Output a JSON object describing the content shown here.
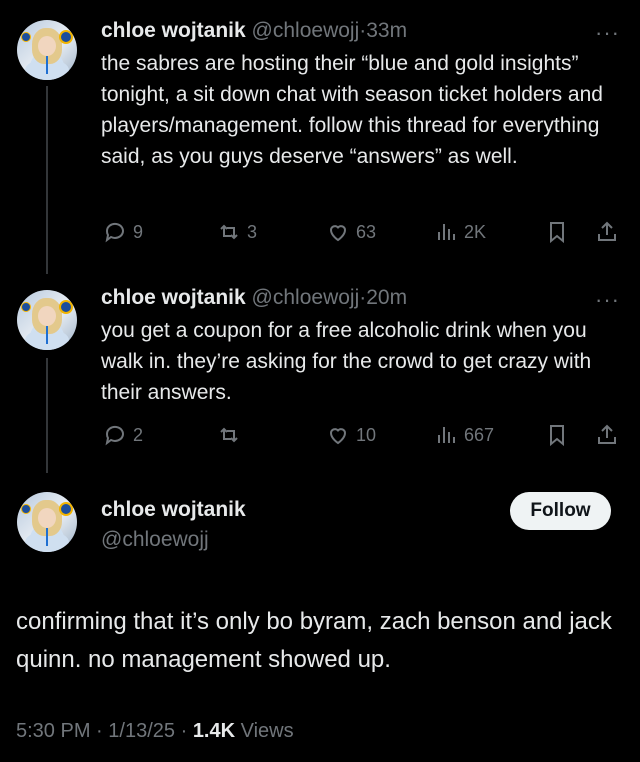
{
  "tweets": [
    {
      "name": "chloe wojtanik",
      "handle": "@chloewojj",
      "sep": "·",
      "time": "33m",
      "more": "···",
      "text": "the sabres are hosting their “blue and gold insights” tonight, a sit down chat with season ticket holders and players/management. follow this thread for everything said, as you guys deserve “answers” as well.",
      "replies": "9",
      "reposts": "3",
      "likes": "63",
      "views": "2K"
    },
    {
      "name": "chloe wojtanik",
      "handle": "@chloewojj",
      "sep": "·",
      "time": "20m",
      "more": "···",
      "text": "you get a coupon for a free alcoholic drink when you walk in. they’re asking for the crowd to get crazy with their answers.",
      "replies": "2",
      "reposts": "",
      "likes": "10",
      "views": "667"
    }
  ],
  "main": {
    "name": "chloe wojtanik",
    "handle": "@chloewojj",
    "follow_label": "Follow",
    "text": "confirming that it’s only bo byram, zach benson and jack quinn. no management showed up.",
    "time": "5:30 PM",
    "date": "1/13/25",
    "sep": "·",
    "views_count": "1.4K",
    "views_label": "Views"
  }
}
